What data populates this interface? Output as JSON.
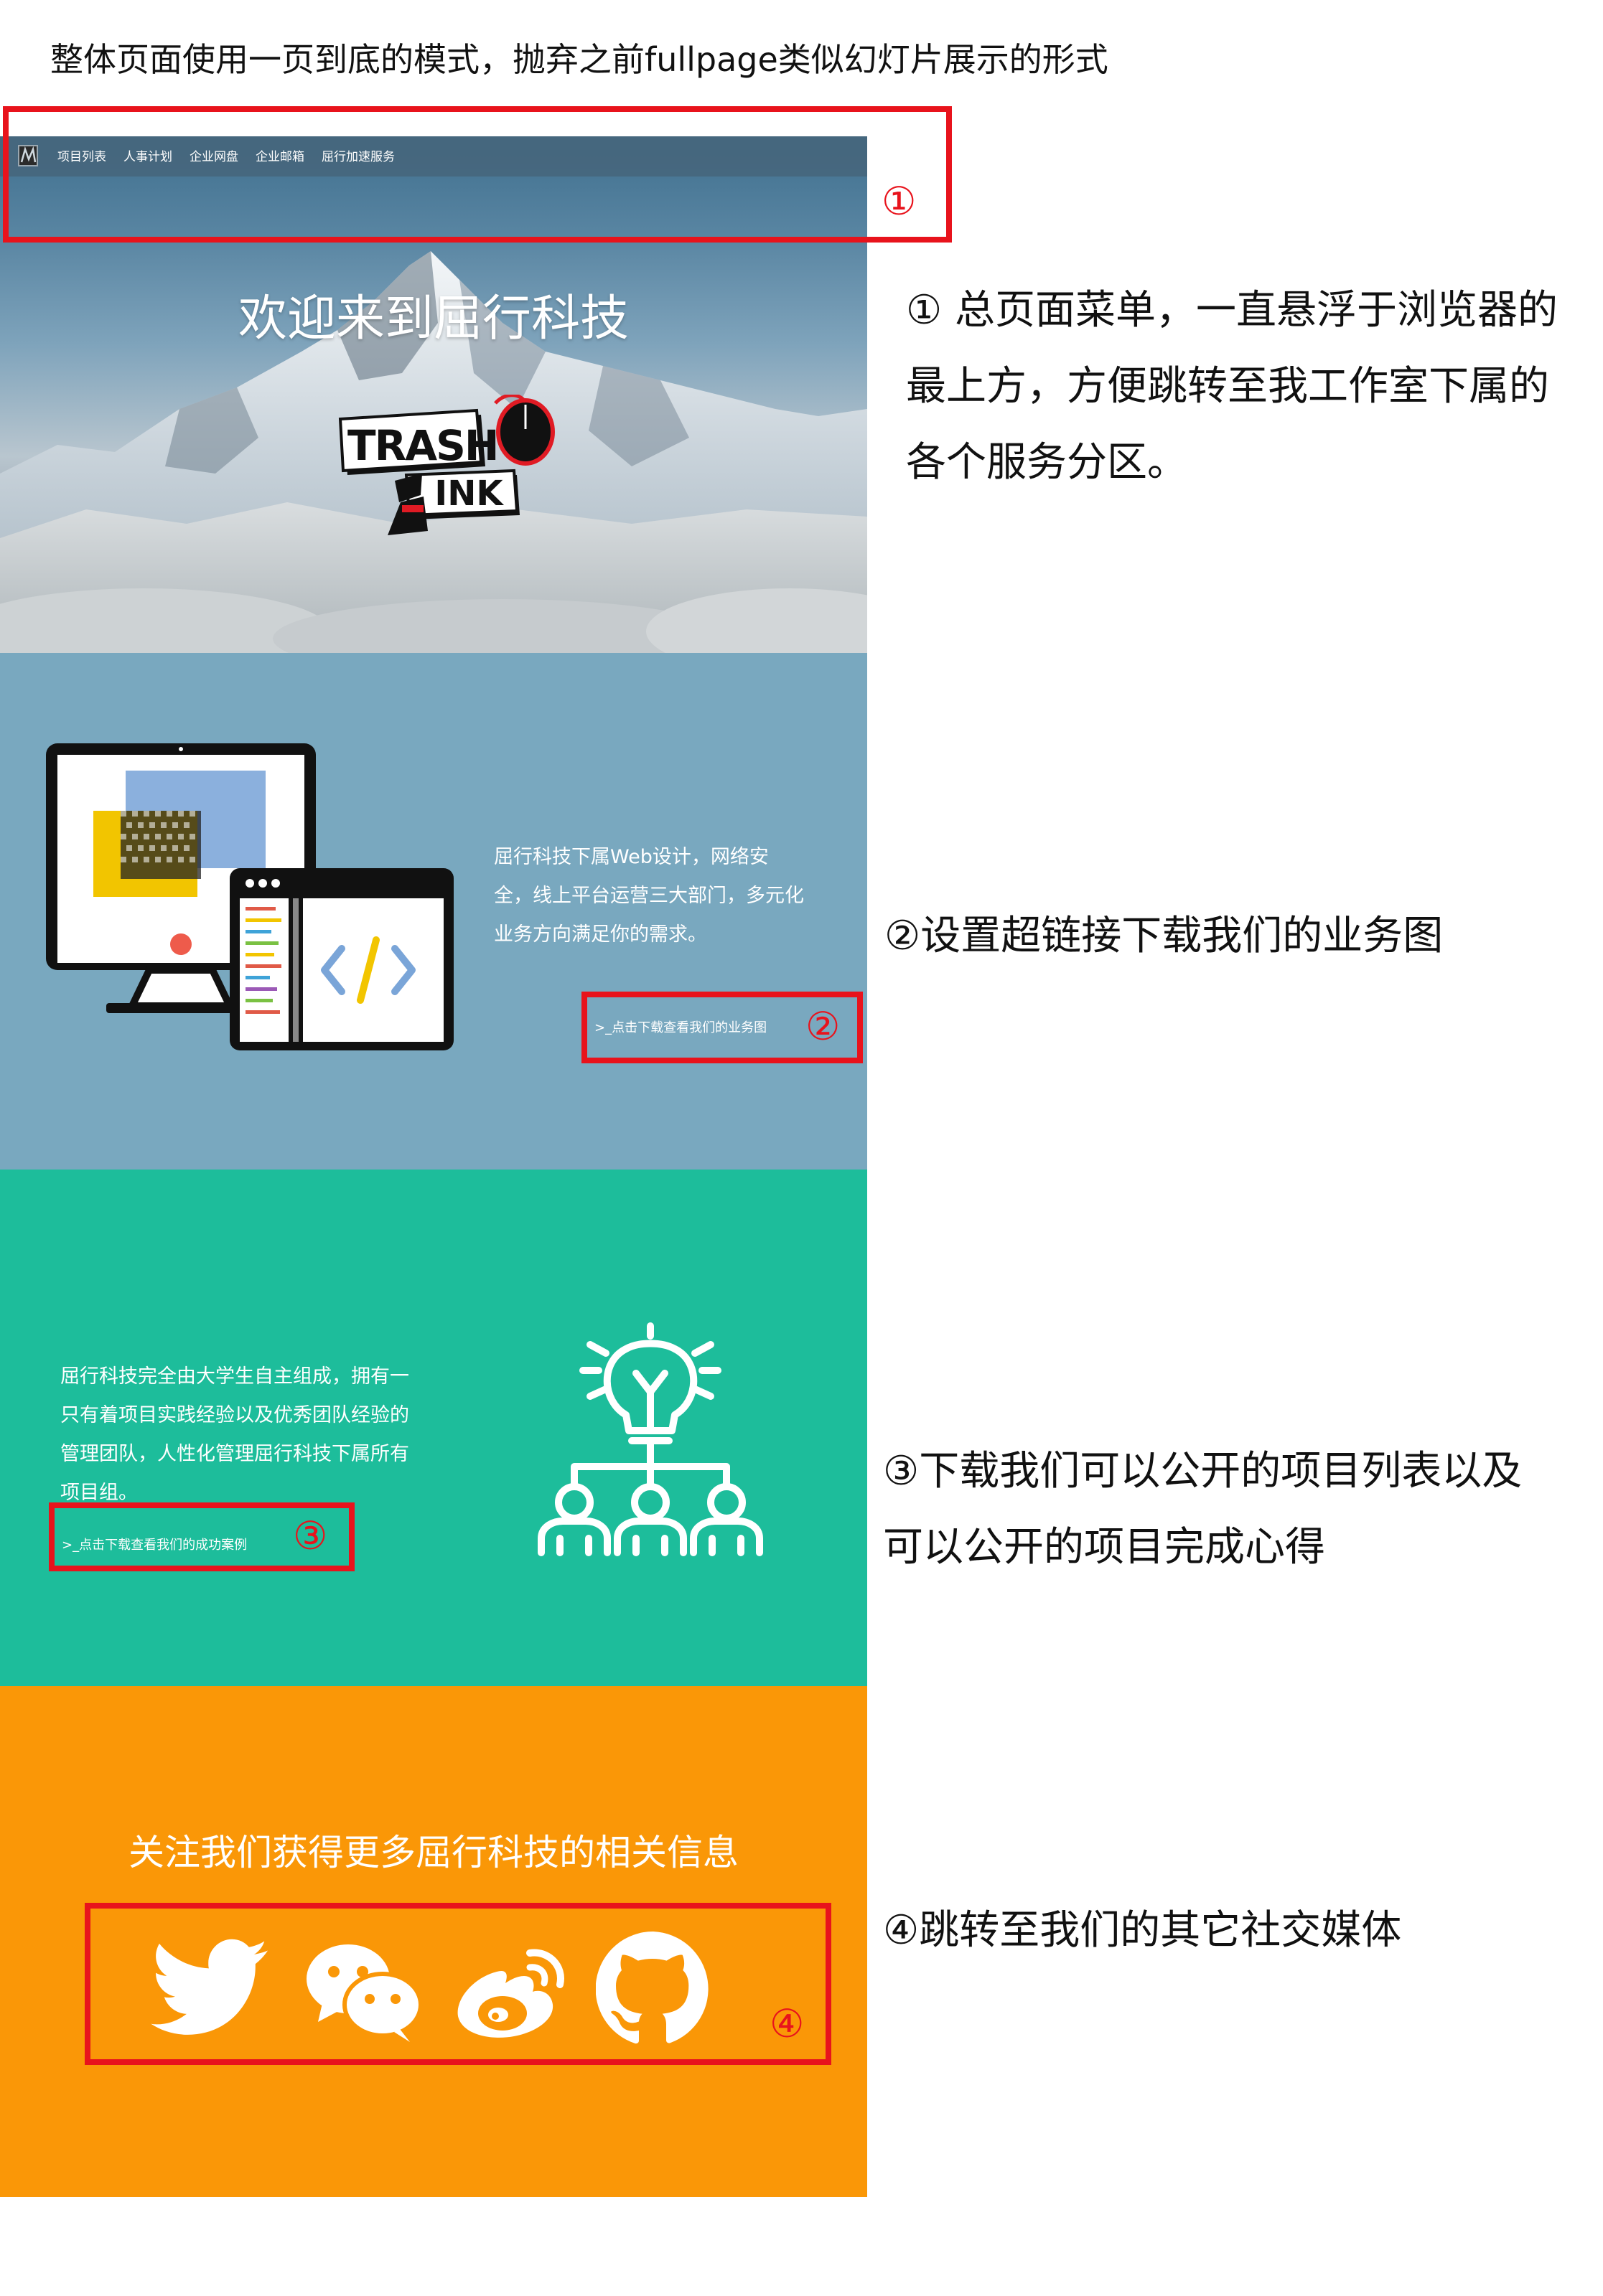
{
  "header_note": "整体页面使用一页到底的模式，抛弃之前fullpage类似幻灯片展示的形式",
  "nav": {
    "items": [
      "项目列表",
      "人事计划",
      "企业网盘",
      "企业邮箱",
      "屈行加速服务"
    ]
  },
  "hero": {
    "title": "欢迎来到屈行科技",
    "logo_line1": "TRASH",
    "logo_line2": "INK"
  },
  "section2": {
    "text": "屈行科技下属Web设计，网络安全，线上平台运营三大部门，多元化业务方向满足你的需求。",
    "link": ">_点击下载查看我们的业务图"
  },
  "section3": {
    "text": "屈行科技完全由大学生自主组成，拥有一只有着项目实践经验以及优秀团队经验的管理团队，人性化管理屈行科技下属所有项目组。",
    "link": ">_点击下载查看我们的成功案例"
  },
  "section4": {
    "title": "关注我们获得更多屈行科技的相关信息",
    "social_icons": [
      "twitter-icon",
      "wechat-icon",
      "weibo-icon",
      "github-icon"
    ]
  },
  "markers": [
    "①",
    "②",
    "③",
    "④"
  ],
  "annotations": {
    "a1": "① 总页面菜单，一直悬浮于浏览器的最上方，方便跳转至我工作室下属的各个服务分区。",
    "a2": "②设置超链接下载我们的业务图",
    "a3": "③下载我们可以公开的项目列表以及可以公开的项目完成心得",
    "a4": "④跳转至我们的其它社交媒体"
  },
  "colors": {
    "annotation_red": "#e8131c",
    "section2_bg": "#79a8bf",
    "section3_bg": "#1dbd9b",
    "section4_bg": "#fa9707"
  }
}
